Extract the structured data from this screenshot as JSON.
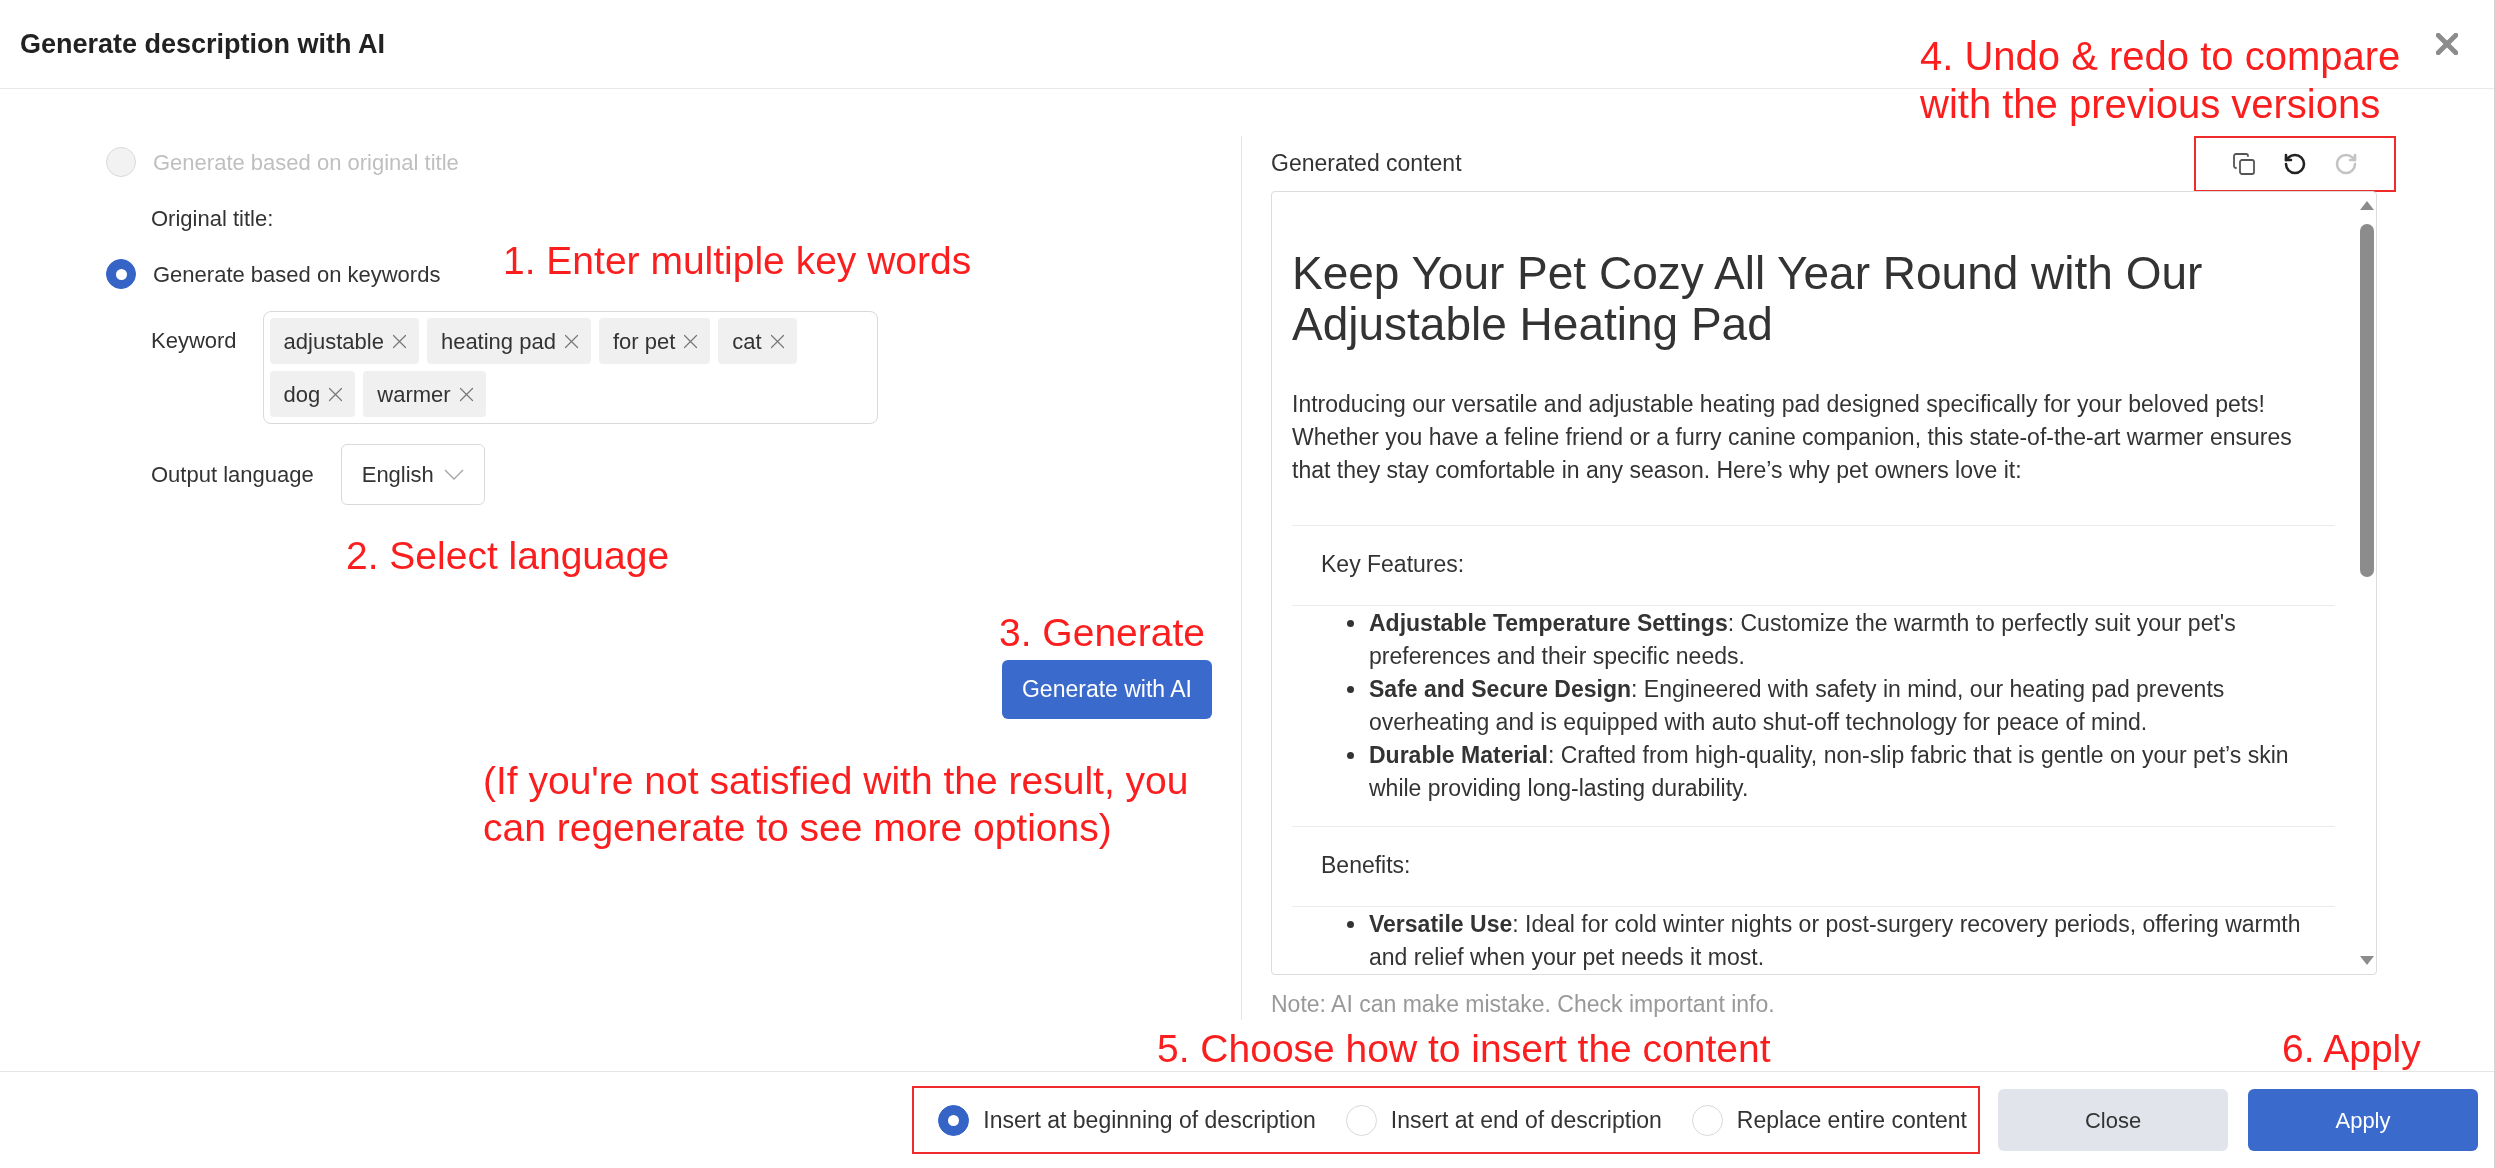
{
  "dialog": {
    "title": "Generate description with AI"
  },
  "source": {
    "options": [
      {
        "label": "Generate based on original title",
        "selected": false,
        "disabled": true
      },
      {
        "label": "Generate based on keywords",
        "selected": true,
        "disabled": false
      }
    ],
    "original_title_label": "Original title:",
    "keyword": {
      "label": "Keyword",
      "tags": [
        "adjustable",
        "heating pad",
        "for pet",
        "cat",
        "dog",
        "warmer"
      ]
    },
    "output_language": {
      "label": "Output language",
      "value": "English"
    },
    "generate_button": "Generate with AI"
  },
  "generated": {
    "label": "Generated content",
    "toolbar": [
      {
        "kind": "copy",
        "disabled": false
      },
      {
        "kind": "undo",
        "disabled": false
      },
      {
        "kind": "redo",
        "disabled": true
      }
    ],
    "heading": "Keep Your Pet Cozy All Year Round with Our Adjustable Heating Pad",
    "intro": "Introducing our versatile and adjustable heating pad designed specifically for your beloved pets! Whether you have a feline friend or a furry canine companion, this state-of-the-art warmer ensures that they stay comfortable in any season. Here’s why pet owners love it:",
    "sections": [
      {
        "title": "Key Features:",
        "items": [
          "**Adjustable Temperature Settings**: Customize the warmth to perfectly suit your pet's preferences and their specific needs.",
          "**Safe and Secure Design**: Engineered with safety in mind, our heating pad prevents overheating and is equipped with auto shut-off technology for peace of mind.",
          "**Durable Material**: Crafted from high-quality, non-slip fabric that is gentle on your pet’s skin while providing long-lasting durability."
        ]
      },
      {
        "title": "Benefits:",
        "items": [
          "**Versatile Use**: Ideal for cold winter nights or post-surgery recovery periods, offering warmth and relief when your pet needs it most."
        ]
      }
    ],
    "note": "Note: AI can make mistake. Check important info."
  },
  "footer": {
    "insert_options": [
      {
        "label": "Insert at beginning of description",
        "selected": true
      },
      {
        "label": "Insert at end of description",
        "selected": false
      },
      {
        "label": "Replace entire content",
        "selected": false
      }
    ],
    "buttons": [
      {
        "label": "Close",
        "kind": "secondary"
      },
      {
        "label": "Apply",
        "kind": "primary"
      }
    ]
  },
  "annotations": [
    "1. Enter multiple key words",
    "2. Select language",
    "3. Generate",
    "(If you're not satisfied with the result, you can regenerate to see more options)",
    "4. Undo & redo to compare with the previous versions",
    "5. Choose how to insert the content",
    "6. Apply"
  ]
}
